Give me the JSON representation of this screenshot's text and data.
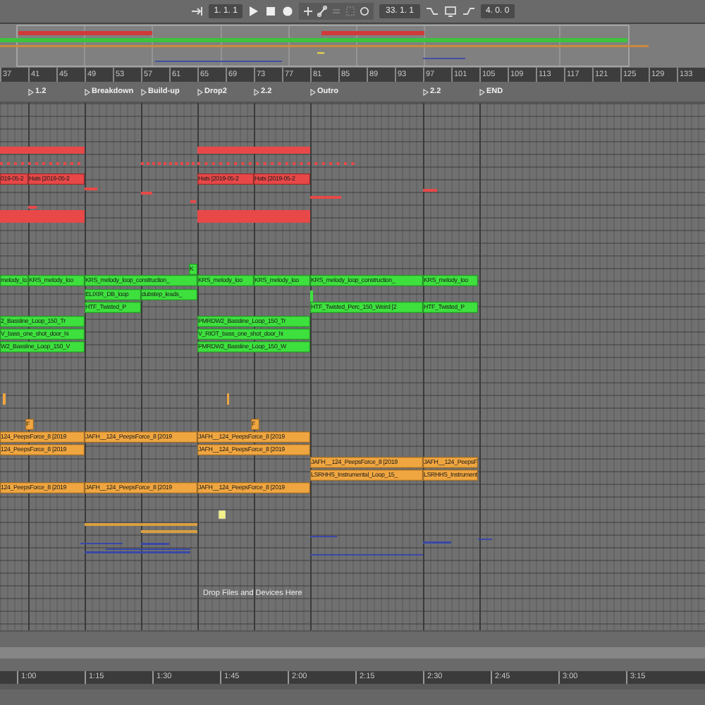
{
  "transport": {
    "position": "1. 1. 1",
    "loop_start": "33. 1. 1",
    "loop_length": "4. 0. 0"
  },
  "bar_ruler": [
    "37",
    "41",
    "45",
    "49",
    "53",
    "57",
    "61",
    "65",
    "69",
    "73",
    "77",
    "81",
    "85",
    "89",
    "93",
    "97",
    "101",
    "105",
    "109",
    "113",
    "117",
    "121",
    "125",
    "129",
    "133"
  ],
  "locators": [
    {
      "label": "1.2"
    },
    {
      "label": "Breakdown"
    },
    {
      "label": "Build-up"
    },
    {
      "label": "Drop2"
    },
    {
      "label": "2.2"
    },
    {
      "label": "Outro"
    },
    {
      "label": "2.2"
    },
    {
      "label": "END"
    }
  ],
  "tracks": [
    {
      "color": "#e84848",
      "clips": [
        {
          "label": "019-05-2"
        },
        {
          "label": "Hats [2019-05-2"
        },
        {
          "label": "Hats [2019-05-2"
        },
        {
          "label": "Hats [2019-05-2"
        }
      ]
    },
    {
      "color": "#3ee03e",
      "clips": [
        {
          "label": "K"
        }
      ]
    },
    {
      "color": "#3ee03e",
      "clips": [
        {
          "label": "melody_lo"
        },
        {
          "label": "KRS_melody_loo"
        },
        {
          "label": "KRS_melody_loop_construction_"
        },
        {
          "label": "KRS_melody_loo"
        },
        {
          "label": "KRS_melody_loo"
        },
        {
          "label": "KRS_melody_loop_construction_"
        },
        {
          "label": "KRS_melody_loo"
        }
      ]
    },
    {
      "color": "#3ee03e",
      "clips": [
        {
          "label": "ELIXIR_DB_loop"
        },
        {
          "label": "dubstep_leads_"
        }
      ]
    },
    {
      "color": "#3ee03e",
      "clips": [
        {
          "label": "HTF_Twisted_P"
        },
        {
          "label": "HTF_Twisted_Perc_150_Weird [2"
        },
        {
          "label": "HTF_Twisted_P"
        }
      ]
    },
    {
      "color": "#3ee03e",
      "clips": [
        {
          "label": "2_Bassline_Loop_150_Tr"
        },
        {
          "label": "PMRDW2_Bassline_Loop_150_Tr"
        }
      ]
    },
    {
      "color": "#3ee03e",
      "clips": [
        {
          "label": "V_bass_one_shot_door_hi"
        },
        {
          "label": "V_RIOT_bass_one_shot_door_hi"
        }
      ]
    },
    {
      "color": "#3ee03e",
      "clips": [
        {
          "label": "W2_Bassline_Loop_150_V"
        },
        {
          "label": "PMRDW2_Bassline_Loop_150_W"
        }
      ]
    },
    {
      "color": "#f0a640",
      "clips": [
        {
          "label": "F"
        },
        {
          "label": "F"
        }
      ]
    },
    {
      "color": "#f0a640",
      "clips": [
        {
          "label": "124_PeepsForce_8 [2019"
        },
        {
          "label": "JAFH__124_PeepsForce_8 [2019"
        },
        {
          "label": "JAFH__124_PeepsForce_8 [2019"
        }
      ]
    },
    {
      "color": "#f0a640",
      "clips": [
        {
          "label": "124_PeepsForce_8 [2019"
        },
        {
          "label": "JAFH__124_PeepsForce_8 [2019"
        }
      ]
    },
    {
      "color": "#f0a640",
      "clips": [
        {
          "label": "JAFH__124_PeepsForce_8 [2019"
        },
        {
          "label": "JAFH__124_PeepsF"
        }
      ]
    },
    {
      "color": "#f0a640",
      "clips": [
        {
          "label": "LSRHHS_Instrumental_Loop_15_"
        },
        {
          "label": "LSRHHS_Instrument"
        }
      ]
    },
    {
      "color": "#f0a640",
      "clips": [
        {
          "label": "124_PeepsForce_8 [2019"
        },
        {
          "label": "JAFH__124_PeepsForce_8 [2019"
        },
        {
          "label": "JAFH__124_PeepsForce_8 [2019"
        }
      ]
    }
  ],
  "drop_hint": "Drop Files and Devices Here",
  "time_ruler": [
    "1:00",
    "1:15",
    "1:30",
    "1:45",
    "2:00",
    "2:15",
    "2:30",
    "2:45",
    "3:00",
    "3:15"
  ]
}
